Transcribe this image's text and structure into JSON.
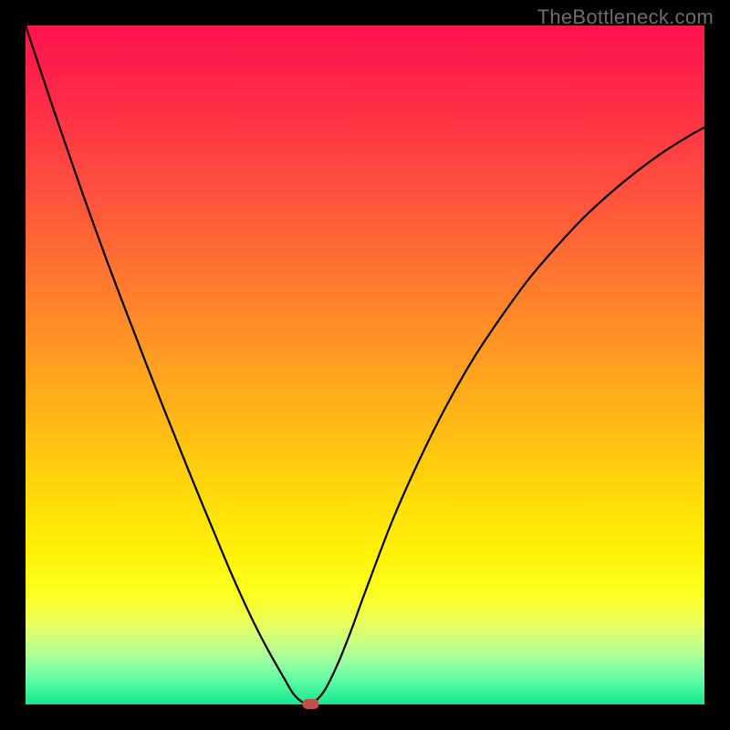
{
  "watermark": "TheBottleneck.com",
  "chart_data": {
    "type": "line",
    "title": "",
    "xlabel": "",
    "ylabel": "",
    "x": [
      0.0,
      0.02,
      0.04,
      0.06,
      0.08,
      0.1,
      0.12,
      0.14,
      0.16,
      0.18,
      0.2,
      0.22,
      0.24,
      0.26,
      0.28,
      0.3,
      0.32,
      0.34,
      0.36,
      0.38,
      0.395,
      0.41,
      0.42,
      0.44,
      0.46,
      0.48,
      0.5,
      0.54,
      0.58,
      0.62,
      0.66,
      0.7,
      0.74,
      0.78,
      0.82,
      0.86,
      0.9,
      0.94,
      0.98,
      1.0
    ],
    "values": [
      1.0,
      0.94,
      0.88,
      0.822,
      0.764,
      0.708,
      0.653,
      0.6,
      0.548,
      0.496,
      0.445,
      0.395,
      0.345,
      0.296,
      0.248,
      0.2,
      0.155,
      0.113,
      0.075,
      0.04,
      0.015,
      0.002,
      0.0,
      0.02,
      0.06,
      0.11,
      0.165,
      0.27,
      0.36,
      0.44,
      0.51,
      0.57,
      0.625,
      0.672,
      0.715,
      0.752,
      0.785,
      0.814,
      0.839,
      0.85
    ],
    "xlim": [
      0,
      1
    ],
    "ylim": [
      0,
      1
    ],
    "marker": {
      "x": 0.42,
      "y": 0.0
    },
    "background_gradient": {
      "top": "#ff1550",
      "mid": "#ffe019",
      "bottom": "#14e78e"
    }
  }
}
